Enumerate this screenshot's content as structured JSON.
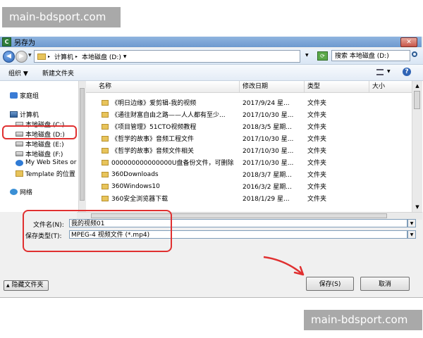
{
  "watermark": {
    "top": "main-bdsport.com",
    "bottom": "main-bdsport.com"
  },
  "dialog": {
    "title": "另存为",
    "close_label": "✕",
    "breadcrumb": [
      "计算机",
      "本地磁盘 (D:)"
    ],
    "search_placeholder": "搜索 本地磁盘 (D:)"
  },
  "toolbar": {
    "organize": "组织 ▼",
    "new_folder": "新建文件夹"
  },
  "nav": {
    "items": [
      {
        "label": "家庭组",
        "icon": "homegroup-icon"
      },
      {
        "label": "计算机",
        "icon": "computer-icon"
      },
      {
        "label": "本地磁盘 (C:)",
        "icon": "drive-icon"
      },
      {
        "label": "本地磁盘 (D:)",
        "icon": "drive-icon"
      },
      {
        "label": "本地磁盘 (E:)",
        "icon": "drive-icon"
      },
      {
        "label": "本地磁盘 (F:)",
        "icon": "drive-icon"
      },
      {
        "label": "My Web Sites or",
        "icon": "web-sites-icon"
      },
      {
        "label": "Template 的位置",
        "icon": "folder-icon"
      },
      {
        "label": "网络",
        "icon": "network-icon"
      }
    ]
  },
  "files": {
    "columns": [
      "名称",
      "修改日期",
      "类型",
      "大小"
    ],
    "rows": [
      {
        "name": "《明日边缘》爱剪辑-我的视频",
        "date": "2017/9/24 星...",
        "type": "文件夹"
      },
      {
        "name": "《通往财富自由之路——人人都有至少...",
        "date": "2017/10/30 星...",
        "type": "文件夹"
      },
      {
        "name": "《项目管理》51CTO视频教程",
        "date": "2018/3/5 星期...",
        "type": "文件夹"
      },
      {
        "name": "《哲学的故事》音频工程文件",
        "date": "2017/10/30 星...",
        "type": "文件夹"
      },
      {
        "name": "《哲学的故事》音频文件相关",
        "date": "2017/10/30 星...",
        "type": "文件夹"
      },
      {
        "name": "000000000000000U盘备份文件，可删除",
        "date": "2017/10/30 星...",
        "type": "文件夹"
      },
      {
        "name": "360Downloads",
        "date": "2018/3/7 星期...",
        "type": "文件夹"
      },
      {
        "name": "360Windows10",
        "date": "2016/3/2 星期...",
        "type": "文件夹"
      },
      {
        "name": "360安全浏览器下载",
        "date": "2018/1/29 星...",
        "type": "文件夹"
      }
    ]
  },
  "form": {
    "filename_label": "文件名(N):",
    "filename_value": "我的视频01",
    "filetype_label": "保存类型(T):",
    "filetype_value": "MPEG-4 视频文件 (*.mp4)"
  },
  "buttons": {
    "hide_folders": "隐藏文件夹",
    "save": "保存(S)",
    "cancel": "取消"
  },
  "colors": {
    "annotation": "#e03030",
    "titlebar": "#6d99cf",
    "folder": "#e8c45b"
  }
}
